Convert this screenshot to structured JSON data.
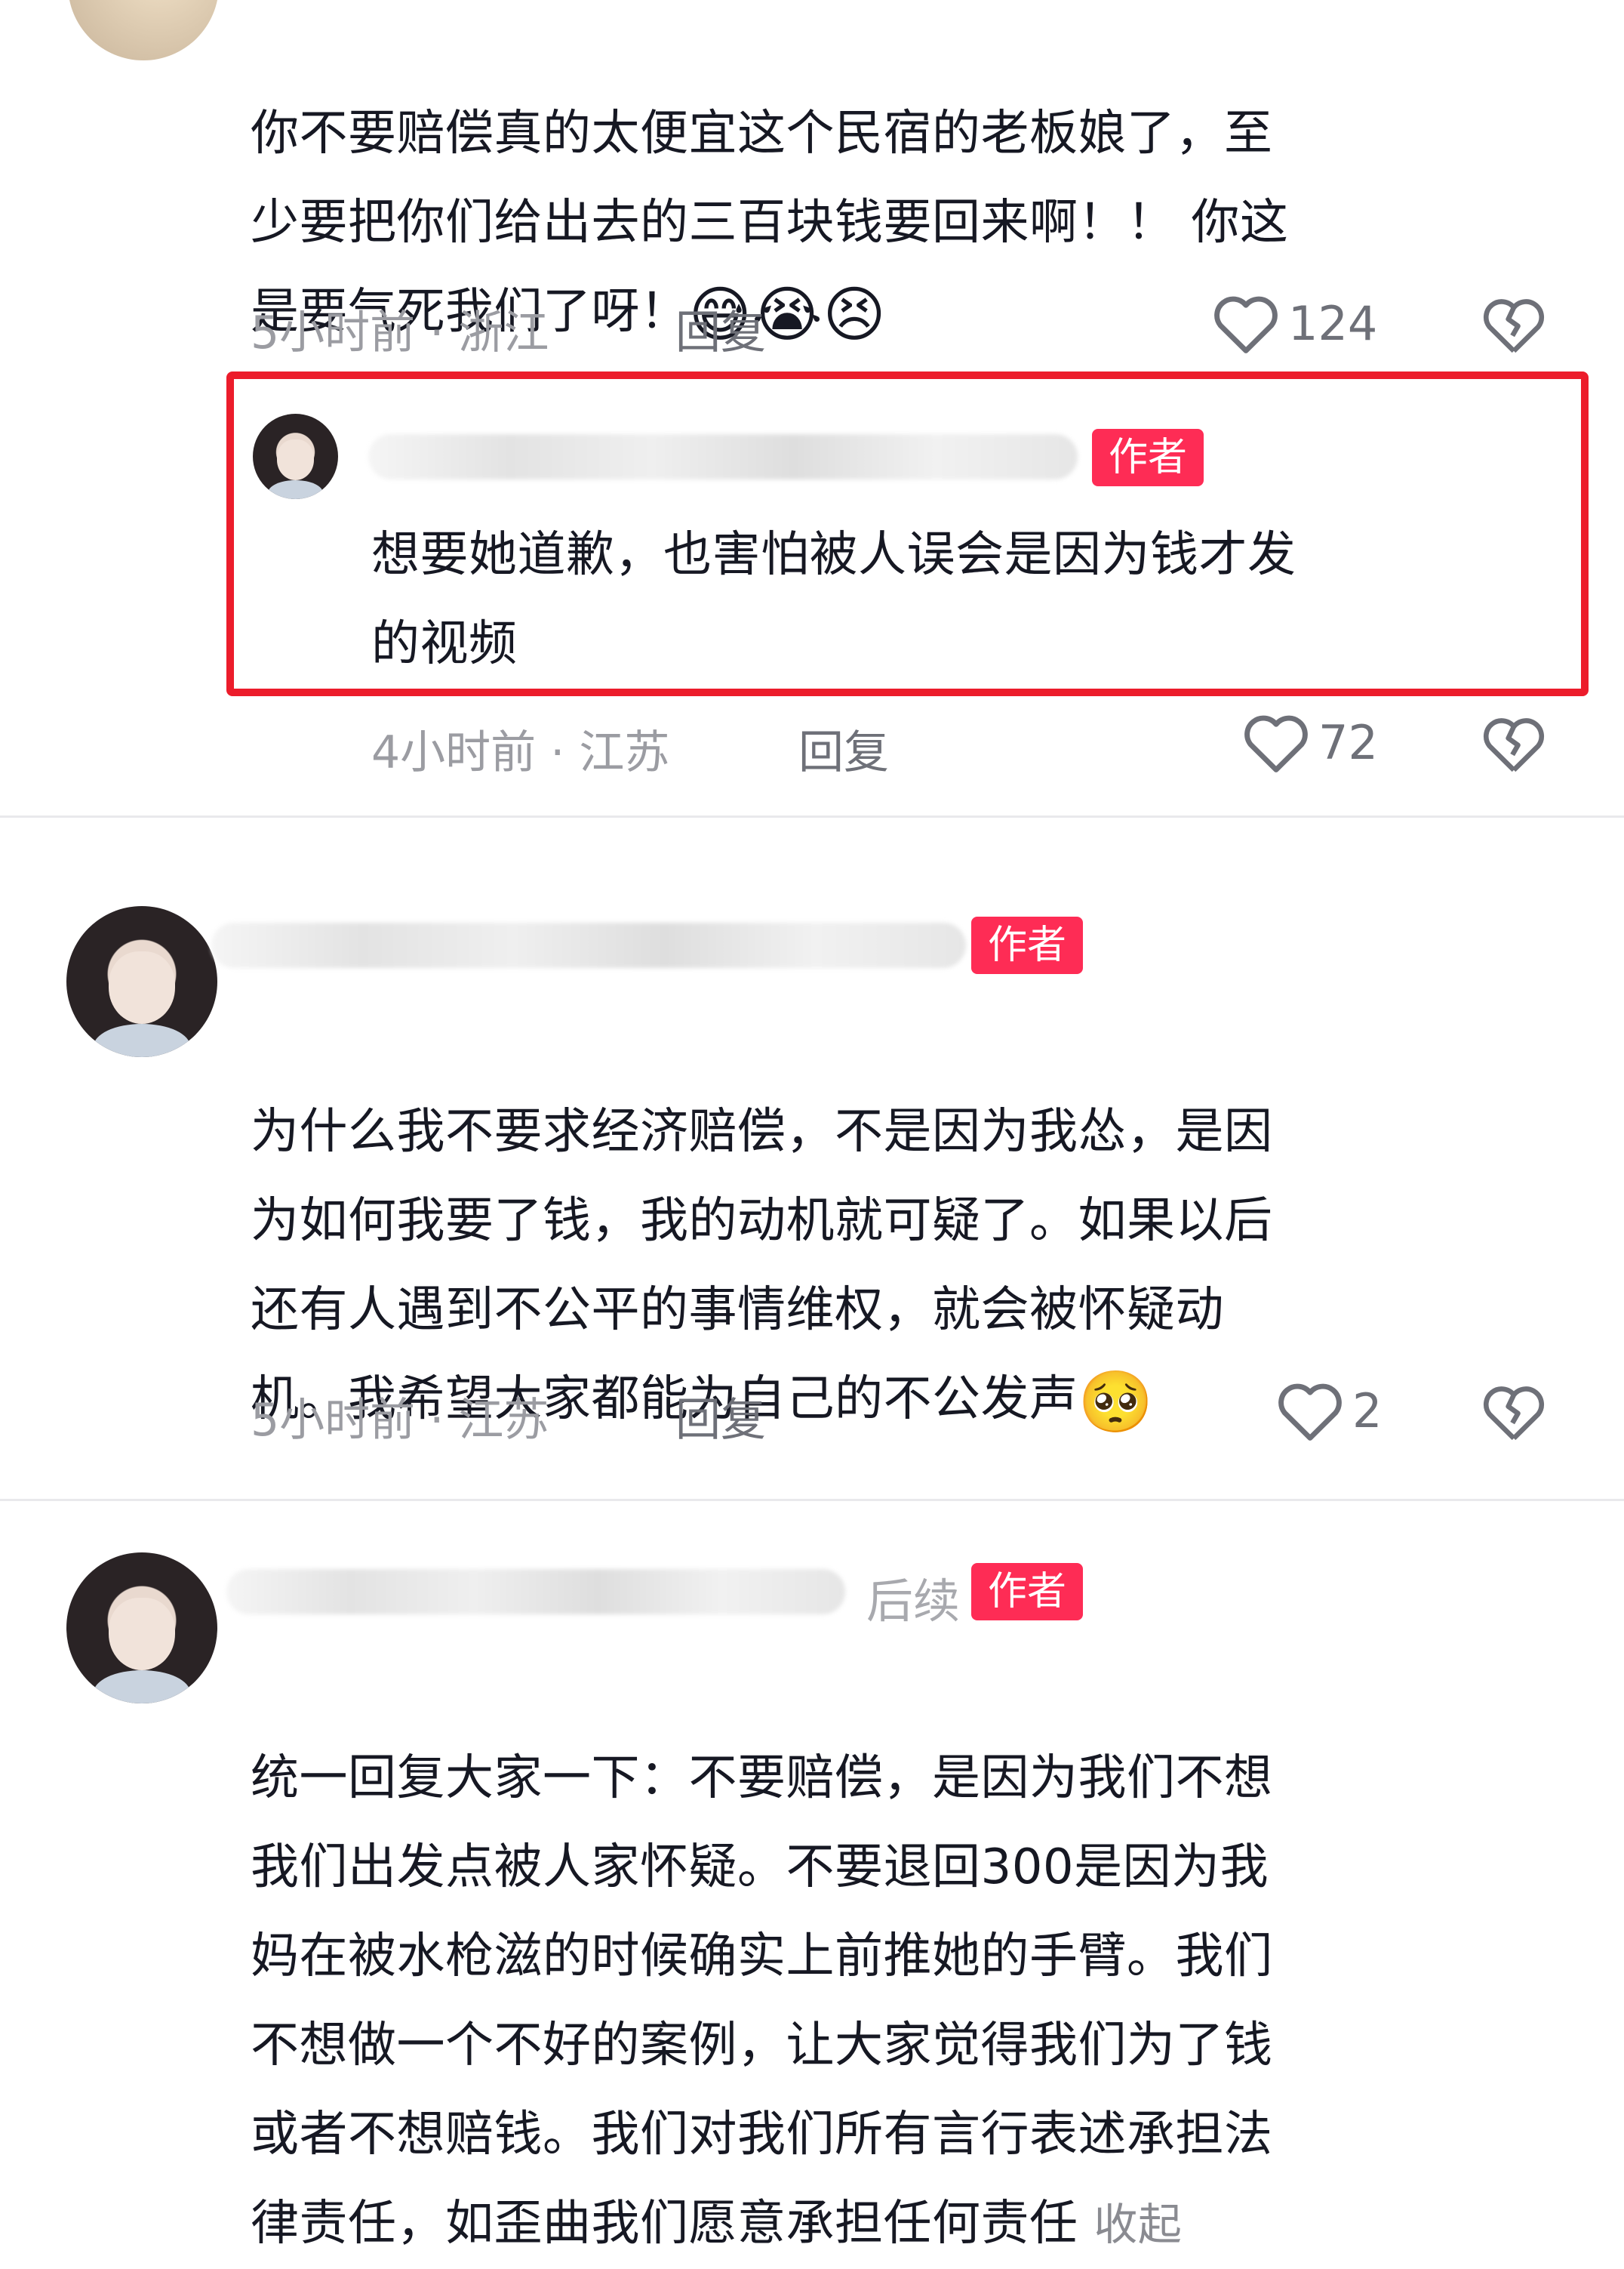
{
  "comments": [
    {
      "text": "你不要赔偿真的太便宜这个民宿的老板娘了，至\n少要把你们给出去的三百块钱要回来啊！！ 你这\n是要气死我们了呀！",
      "emoji": "😅😭😣",
      "time_location": "5小时前 · 浙江",
      "reply_label": "回复",
      "likes": "124"
    },
    {
      "badge": "作者",
      "text": "想要她道歉，也害怕被人误会是因为钱才发\n的视频",
      "time_location": "4小时前 · 江苏",
      "reply_label": "回复",
      "likes": "72"
    },
    {
      "badge": "作者",
      "text": "为什么我不要求经济赔偿，不是因为我怂，是因\n为如何我要了钱，我的动机就可疑了。如果以后\n还有人遇到不公平的事情维权，就会被怀疑动\n机。我希望大家都能为自己的不公发声",
      "emoji": "🥺",
      "time_location": "5小时前 · 江苏",
      "reply_label": "回复",
      "likes": "2"
    },
    {
      "name_suffix": "后续",
      "badge": "作者",
      "text": "统一回复大家一下：不要赔偿，是因为我们不想\n我们出发点被人家怀疑。不要退回300是因为我\n妈在被水枪滋的时候确实上前推她的手臂。我们\n不想做一个不好的案例，让大家觉得我们为了钱\n或者不想赔钱。我们对我们所有言行表述承担法\n律责任，如歪曲我们愿意承担任何责任",
      "collapse_label": "收起"
    }
  ],
  "colors": {
    "badge": "#fe2c55",
    "highlight_box": "#ec1c2b",
    "meta": "#9b9ca2"
  }
}
